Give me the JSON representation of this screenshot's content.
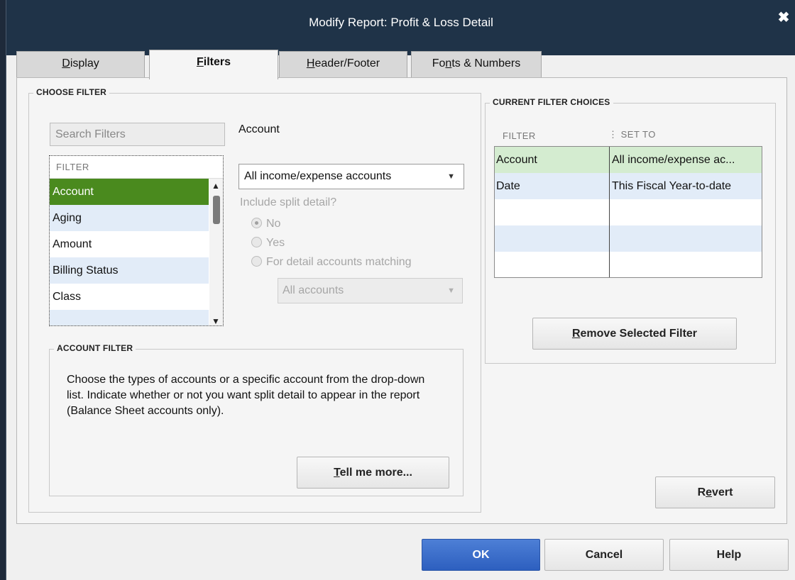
{
  "window": {
    "title": "Modify Report: Profit & Loss Detail",
    "close_glyph": "✖"
  },
  "tabs": [
    {
      "pre": "",
      "u": "D",
      "post": "isplay"
    },
    {
      "pre": "",
      "u": "F",
      "post": "ilters"
    },
    {
      "pre": "",
      "u": "H",
      "post": "eader/Footer"
    },
    {
      "pre": "Fo",
      "u": "n",
      "post": "ts & Numbers"
    }
  ],
  "choose_filter": {
    "label": "CHOOSE FILTER",
    "search_placeholder": "Search Filters",
    "list_header": "FILTER",
    "items": [
      "Account",
      "Aging",
      "Amount",
      "Billing Status",
      "Class"
    ],
    "selected": "Account"
  },
  "account": {
    "label": "Account",
    "dropdown_value": "All income/expense accounts",
    "split_question": "Include split detail?",
    "radio_no": "No",
    "radio_yes": "Yes",
    "radio_matching": "For detail accounts matching",
    "sub_dropdown_value": "All accounts"
  },
  "account_filter": {
    "label": "ACCOUNT FILTER",
    "description": "Choose the types of accounts or a specific account from the drop-down list. Indicate whether or not you want split detail to appear in the report (Balance Sheet accounts only).",
    "tell_me_pre": "",
    "tell_me_u": "T",
    "tell_me_post": "ell me more..."
  },
  "current_filters": {
    "label": "CURRENT FILTER CHOICES",
    "col_filter": "FILTER",
    "col_set_to": "SET TO",
    "rows": [
      {
        "filter": "Account",
        "set_to": "All income/expense ac..."
      },
      {
        "filter": "Date",
        "set_to": "This Fiscal Year-to-date"
      }
    ],
    "remove_pre": "",
    "remove_u": "R",
    "remove_post": "emove Selected Filter"
  },
  "buttons": {
    "revert_pre": "R",
    "revert_u": "e",
    "revert_post": "vert",
    "ok": "OK",
    "cancel": "Cancel",
    "help": "Help"
  },
  "colors": {
    "titlebar": "#1f3348",
    "selected_row": "#4a8a1e",
    "alt_row": "#e2ecf8",
    "ok_button": "#2d5fbf"
  }
}
